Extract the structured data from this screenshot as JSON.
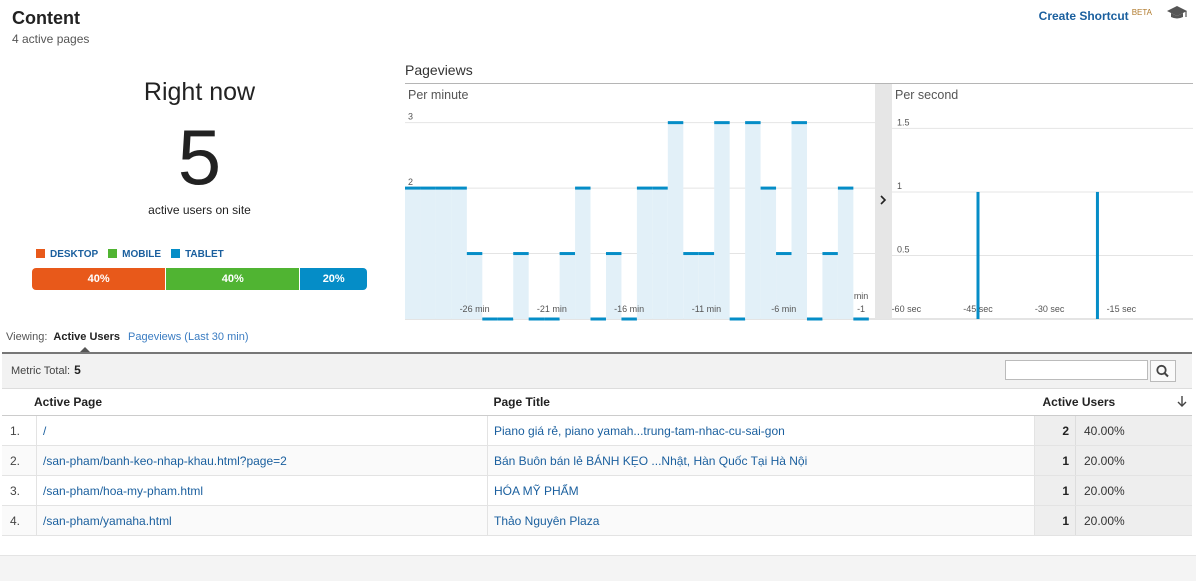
{
  "header": {
    "title": "Content",
    "subtitle": "4 active pages",
    "shortcut_label": "Create Shortcut",
    "shortcut_badge": "BETA",
    "hat_icon": "graduation-cap-icon"
  },
  "summary": {
    "heading": "Right now",
    "active_users": "5",
    "active_label": "active users on site",
    "devices": [
      {
        "label": "DESKTOP",
        "pct_label": "40%",
        "share": 0.4,
        "color": "#e8591a"
      },
      {
        "label": "MOBILE",
        "pct_label": "40%",
        "share": 0.4,
        "color": "#50b432"
      },
      {
        "label": "TABLET",
        "pct_label": "20%",
        "share": 0.2,
        "color": "#058dc7"
      }
    ]
  },
  "pageviews": {
    "label": "Pageviews",
    "expand_icon": "chevron-right-icon"
  },
  "chart_data": [
    {
      "type": "bar",
      "title": "Per minute",
      "x": [
        -30,
        -29,
        -28,
        -27,
        -26,
        -25,
        -24,
        -23,
        -22,
        -21,
        -20,
        -19,
        -18,
        -17,
        -16,
        -15,
        -14,
        -13,
        -12,
        -11,
        -10,
        -9,
        -8,
        -7,
        -6,
        -5,
        -4,
        -3,
        -2,
        -1
      ],
      "values": [
        2,
        2,
        2,
        2,
        1,
        0,
        0,
        1,
        0,
        0,
        1,
        2,
        0,
        1,
        0,
        2,
        2,
        3,
        1,
        1,
        3,
        0,
        3,
        2,
        1,
        3,
        0,
        1,
        2,
        0
      ],
      "xticks": [
        {
          "x": -26,
          "label": "-26 min"
        },
        {
          "x": -21,
          "label": "-21 min"
        },
        {
          "x": -16,
          "label": "-16 min"
        },
        {
          "x": -11,
          "label": "-11 min"
        },
        {
          "x": -6,
          "label": "-6 min"
        },
        {
          "x": -1,
          "label": "-1"
        },
        {
          "x": -1,
          "label": "min"
        }
      ],
      "yticks": [
        {
          "y": 1,
          "label": "1"
        },
        {
          "y": 2,
          "label": "2"
        },
        {
          "y": 3,
          "label": "3"
        }
      ],
      "ylim": [
        0,
        3.3
      ],
      "color": "#058dc7"
    },
    {
      "type": "bar",
      "title": "Per second",
      "x": [
        -45,
        -20
      ],
      "values": [
        1,
        1
      ],
      "xlim": [
        -63,
        0
      ],
      "xticks": [
        {
          "x": -60,
          "label": "-60 sec"
        },
        {
          "x": -45,
          "label": "-45 sec"
        },
        {
          "x": -30,
          "label": "-30 sec"
        },
        {
          "x": -15,
          "label": "-15 sec"
        }
      ],
      "yticks": [
        {
          "y": 0.5,
          "label": "0.5"
        },
        {
          "y": 1,
          "label": "1"
        },
        {
          "y": 1.5,
          "label": "1.5"
        }
      ],
      "ylim": [
        0,
        1.7
      ],
      "color": "#058dc7"
    }
  ],
  "viewing": {
    "label": "Viewing:",
    "active_tab": "Active Users",
    "other_tab": "Pageviews (Last 30 min)"
  },
  "metric": {
    "label": "Metric Total:",
    "value": "5",
    "search_placeholder": "",
    "search_icon": "search-icon"
  },
  "table": {
    "headers": {
      "page": "Active Page",
      "title": "Page Title",
      "users": "Active Users"
    },
    "sort_icon": "arrow-down-icon",
    "rows": [
      {
        "idx": "1.",
        "page": "/",
        "title": "Piano giá rẻ, piano yamah...trung-tam-nhac-cu-sai-gon",
        "users": "2",
        "pct": "40.00%"
      },
      {
        "idx": "2.",
        "page": "/san-pham/banh-keo-nhap-khau.html?page=2",
        "title": "Bán Buôn bán lẻ BÁNH KẸO ...Nhật, Hàn Quốc Tại Hà Nội",
        "users": "1",
        "pct": "20.00%"
      },
      {
        "idx": "3.",
        "page": "/san-pham/hoa-my-pham.html",
        "title": "HÓA MỸ PHẨM",
        "users": "1",
        "pct": "20.00%"
      },
      {
        "idx": "4.",
        "page": "/san-pham/yamaha.html",
        "title": "Thảo Nguyên Plaza",
        "users": "1",
        "pct": "20.00%"
      }
    ]
  }
}
